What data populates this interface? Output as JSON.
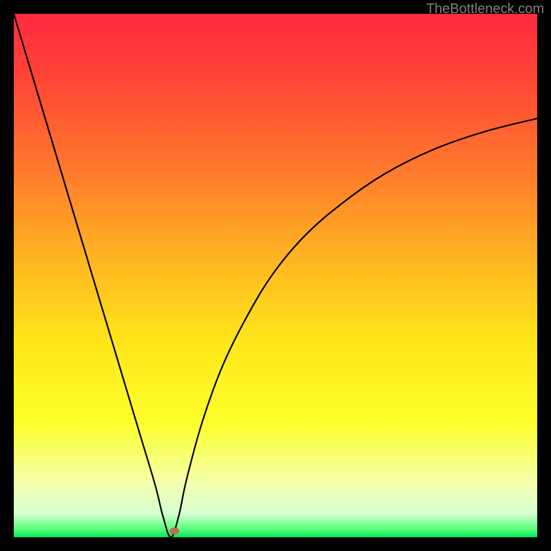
{
  "watermark_text": "TheBottleneck.com",
  "chart_data": {
    "type": "line",
    "title": "",
    "xlabel": "",
    "ylabel": "",
    "xlim": [
      0,
      100
    ],
    "ylim": [
      0,
      100
    ],
    "background": {
      "style": "vertical-gradient",
      "description": "Vertical gradient from red at top through orange, yellow, pale yellow to bright green at bottom, representing bottleneck severity (red = high, green = low).",
      "stops": [
        {
          "offset": 0.0,
          "color": "#ff2a3f"
        },
        {
          "offset": 0.12,
          "color": "#ff4436"
        },
        {
          "offset": 0.3,
          "color": "#ff7a2c"
        },
        {
          "offset": 0.48,
          "color": "#ffb821"
        },
        {
          "offset": 0.62,
          "color": "#ffe41a"
        },
        {
          "offset": 0.78,
          "color": "#feff2a"
        },
        {
          "offset": 0.9,
          "color": "#f3ffb0"
        },
        {
          "offset": 0.955,
          "color": "#d6ffd0"
        },
        {
          "offset": 0.985,
          "color": "#55ff7a"
        },
        {
          "offset": 1.0,
          "color": "#00e45a"
        }
      ]
    },
    "series": [
      {
        "name": "bottleneck-curve",
        "description": "V-shaped bottleneck curve; x is relative component score, y is bottleneck percentage. Minimum near x≈30 where bottleneck≈0, rising sharply toward 100 on the left and asymptotically toward ~80 on the right.",
        "x": [
          0,
          3,
          6,
          9,
          12,
          15,
          18,
          21,
          24,
          27,
          28.5,
          30,
          31.5,
          33,
          36,
          40,
          45,
          50,
          56,
          63,
          71,
          80,
          90,
          100
        ],
        "y": [
          100,
          90,
          80,
          70,
          60,
          50,
          40,
          30,
          20,
          10,
          4,
          0,
          4,
          11,
          22,
          33,
          43,
          51,
          58,
          64,
          69.5,
          74,
          77.5,
          80
        ]
      }
    ],
    "marker": {
      "name": "optimal-point",
      "x": 30.7,
      "y": 1.2,
      "color": "#c06a5a",
      "rx": 7,
      "ry": 5
    }
  }
}
